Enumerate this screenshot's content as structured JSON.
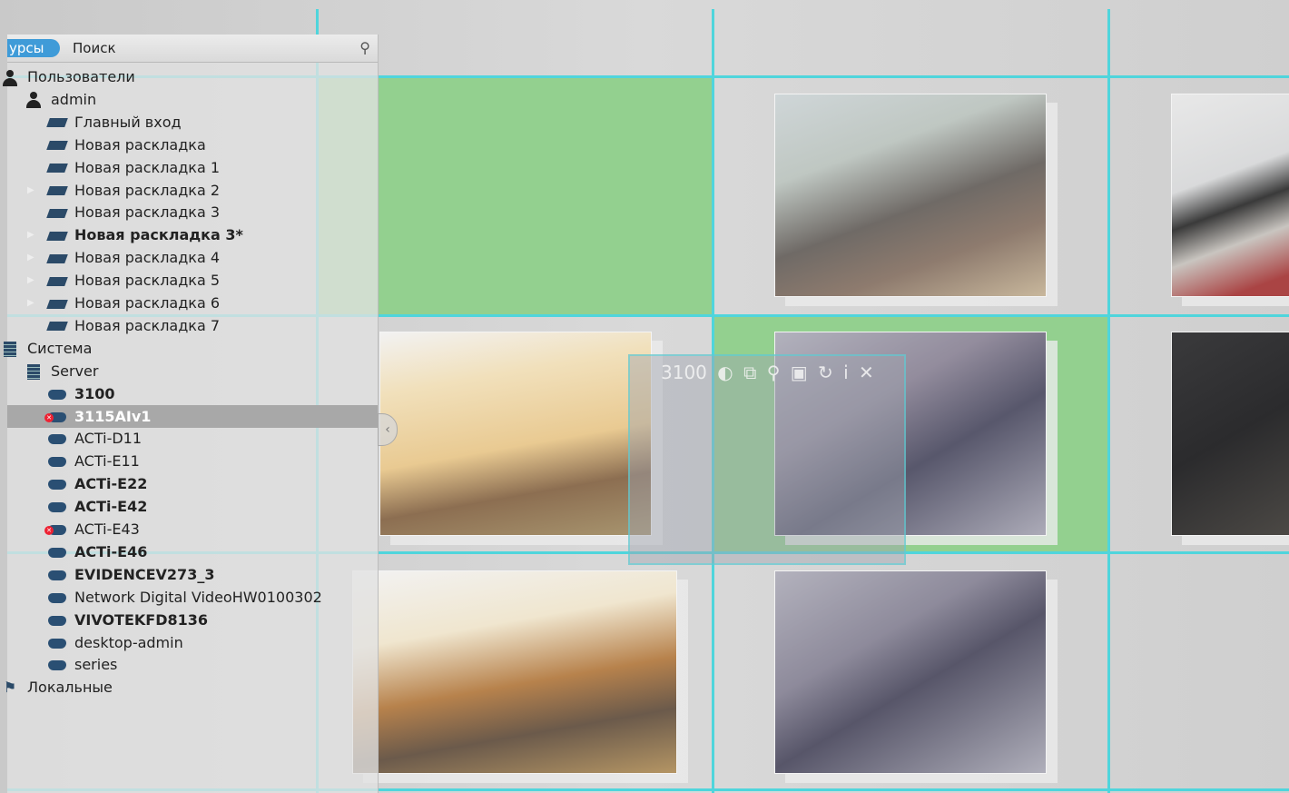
{
  "sidebar": {
    "tab_resources": "урсы",
    "tab_search": "Поиск",
    "pin_icon": "pin-icon",
    "users_group": "Пользователи",
    "user_name": "admin",
    "layouts": [
      {
        "label": "Главный вход",
        "bold": false,
        "expandable": false
      },
      {
        "label": "Новая раскладка",
        "bold": false,
        "expandable": false
      },
      {
        "label": "Новая раскладка 1",
        "bold": false,
        "expandable": false
      },
      {
        "label": "Новая раскладка 2",
        "bold": false,
        "expandable": true
      },
      {
        "label": "Новая раскладка 3",
        "bold": false,
        "expandable": false
      },
      {
        "label": "Новая раскладка 3*",
        "bold": true,
        "expandable": true
      },
      {
        "label": "Новая раскладка 4",
        "bold": false,
        "expandable": true
      },
      {
        "label": "Новая раскладка 5",
        "bold": false,
        "expandable": true
      },
      {
        "label": "Новая раскладка 6",
        "bold": false,
        "expandable": true
      },
      {
        "label": "Новая раскладка 7",
        "bold": false,
        "expandable": false
      }
    ],
    "system_group": "Система",
    "server_name": "Server",
    "cameras": [
      {
        "label": "3100",
        "bold": true,
        "error": false,
        "selected": false
      },
      {
        "label": "3115AIv1",
        "bold": true,
        "error": true,
        "selected": true
      },
      {
        "label": "ACTi-D11",
        "bold": false,
        "error": false,
        "selected": false
      },
      {
        "label": "ACTi-E11",
        "bold": false,
        "error": false,
        "selected": false
      },
      {
        "label": "ACTi-E22",
        "bold": true,
        "error": false,
        "selected": false
      },
      {
        "label": "ACTi-E42",
        "bold": true,
        "error": false,
        "selected": false
      },
      {
        "label": "ACTi-E43",
        "bold": false,
        "error": true,
        "selected": false
      },
      {
        "label": "ACTi-E46",
        "bold": true,
        "error": false,
        "selected": false
      },
      {
        "label": "EVIDENCEV273_3",
        "bold": true,
        "error": false,
        "selected": false
      },
      {
        "label": "Network Digital VideoHW0100302",
        "bold": false,
        "error": false,
        "selected": false
      },
      {
        "label": "VIVOTEKFD8136",
        "bold": true,
        "error": false,
        "selected": false
      },
      {
        "label": "desktop-admin",
        "bold": false,
        "error": false,
        "selected": false
      },
      {
        "label": "series",
        "bold": false,
        "error": false,
        "selected": false
      }
    ],
    "local_group": "Локальные"
  },
  "toolbar": {
    "camera_name": "3100",
    "icons": [
      "contrast-icon",
      "layout-icon",
      "zoom-icon",
      "screenshot-icon",
      "rotate-icon",
      "info-icon",
      "close-icon"
    ]
  },
  "colors": {
    "grid_line": "#4fd5dc",
    "drop_target": "#93d08f",
    "selected_tab": "#3f9bd8",
    "camera_icon": "#2a4f73"
  }
}
